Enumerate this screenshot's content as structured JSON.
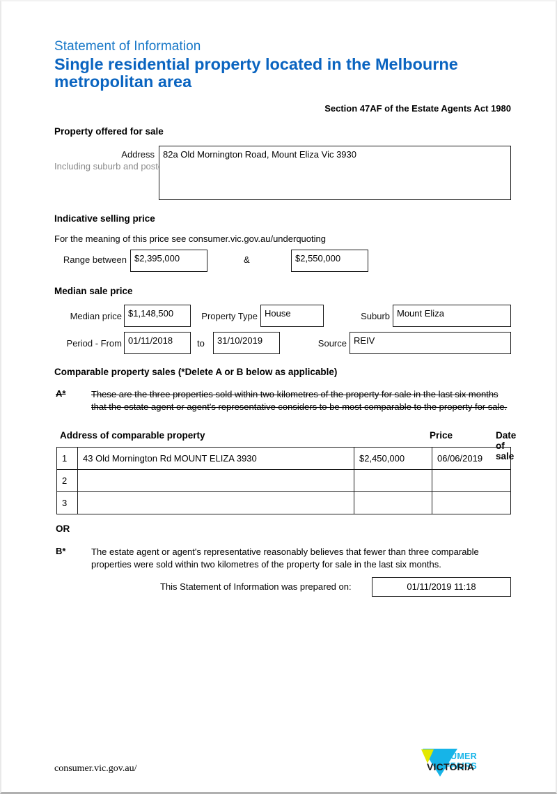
{
  "header": {
    "subtitle": "Statement of Information",
    "title": "Single residential property located in the Melbourne metropolitan area",
    "act_reference": "Section 47AF of the Estate Agents Act 1980",
    "accent_color": "#0a64c0"
  },
  "property": {
    "section_heading": "Property offered for sale",
    "address_label": "Address",
    "address_sublabel": "Including suburb and postcode",
    "address_value": "82a Old Mornington Road, Mount Eliza Vic 3930"
  },
  "indicative": {
    "section_heading": "Indicative selling price",
    "meaning_note": "For the meaning of this price see consumer.vic.gov.au/underquoting",
    "range_label": "Range between",
    "range_low": "$2,395,000",
    "ampersand": "&",
    "range_high": "$2,550,000"
  },
  "median": {
    "section_heading": "Median sale price",
    "median_price_label": "Median price",
    "median_price_value": "$1,148,500",
    "property_type_label": "Property Type",
    "property_type_value": "House",
    "suburb_label": "Suburb",
    "suburb_value": "Mount Eliza",
    "period_from_label": "Period - From",
    "period_from_value": "01/11/2018",
    "to_label": "to",
    "period_to_value": "31/10/2019",
    "source_label": "Source",
    "source_value": "REIV"
  },
  "comparable": {
    "section_heading": "Comparable property sales (*Delete A or B below as applicable)",
    "option_a_marker": "A*",
    "option_a_text": "These are the three properties sold within two kilometres of the property for sale in the last six months that the estate agent or agent's representative considers to be most comparable to the property for sale.",
    "columns": [
      "Address of comparable property",
      "Price",
      "Date of sale"
    ],
    "rows": [
      {
        "num": "1",
        "address": "43 Old Mornington Rd MOUNT ELIZA 3930",
        "price": "$2,450,000",
        "date": "06/06/2019"
      },
      {
        "num": "2",
        "address": "",
        "price": "",
        "date": ""
      },
      {
        "num": "3",
        "address": "",
        "price": "",
        "date": ""
      }
    ],
    "or_label": "OR",
    "option_b_marker": "B*",
    "option_b_text": "The estate agent or agent's representative reasonably believes that fewer than three comparable properties were sold within two kilometres of the property for sale in the last six months."
  },
  "prepared": {
    "label": "This Statement of Information was prepared on:",
    "value": "01/11/2019 11:18"
  },
  "footer": {
    "url": "consumer.vic.gov.au/",
    "logo_line1": "CONSUMER",
    "logo_line2": "AFFAIRS",
    "logo_victoria": "VICTORIA",
    "logo_cyan": "#16b4e8",
    "logo_yellow": "#e3e800"
  }
}
